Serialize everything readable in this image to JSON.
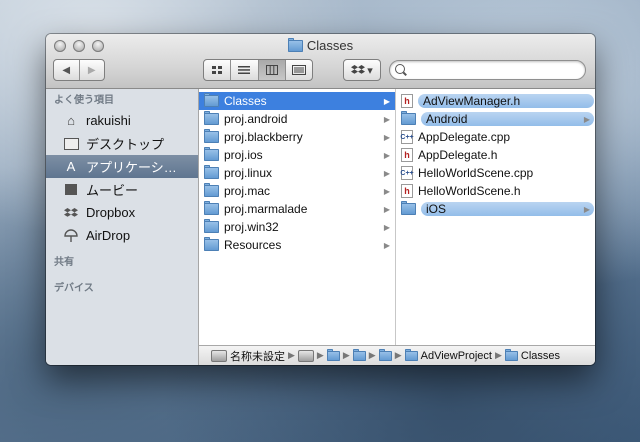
{
  "window": {
    "title": "Classes"
  },
  "toolbar": {
    "back_icon": "◀",
    "forward_icon": "▶",
    "view_icons": [
      "icon-view-icon",
      "list-view-icon",
      "column-view-icon",
      "coverflow-view-icon"
    ],
    "dropbox_menu_arrow": "▾",
    "search_placeholder": ""
  },
  "sidebar": {
    "sections": {
      "favorites": "よく使う項目",
      "shared": "共有",
      "devices": "デバイス"
    },
    "items": [
      {
        "label": "rakuishi",
        "icon": "home-icon"
      },
      {
        "label": "デスクトップ",
        "icon": "desktop-icon"
      },
      {
        "label": "アプリケーシ…",
        "icon": "applications-icon",
        "selected": true
      },
      {
        "label": "ムービー",
        "icon": "movies-icon"
      },
      {
        "label": "Dropbox",
        "icon": "dropbox-icon"
      },
      {
        "label": "AirDrop",
        "icon": "airdrop-icon"
      }
    ]
  },
  "column1": [
    {
      "label": "Classes",
      "selected": true
    },
    {
      "label": "proj.android"
    },
    {
      "label": "proj.blackberry"
    },
    {
      "label": "proj.ios"
    },
    {
      "label": "proj.linux"
    },
    {
      "label": "proj.mac"
    },
    {
      "label": "proj.marmalade"
    },
    {
      "label": "proj.win32"
    },
    {
      "label": "Resources"
    }
  ],
  "column2": [
    {
      "label": "AdViewManager.h",
      "type": "h",
      "highlight": true
    },
    {
      "label": "Android",
      "type": "folder",
      "highlight": true
    },
    {
      "label": "AppDelegate.cpp",
      "type": "cpp"
    },
    {
      "label": "AppDelegate.h",
      "type": "h"
    },
    {
      "label": "HelloWorldScene.cpp",
      "type": "cpp"
    },
    {
      "label": "HelloWorldScene.h",
      "type": "h"
    },
    {
      "label": "iOS",
      "type": "folder",
      "highlight": true
    }
  ],
  "pathbar": {
    "disk": "名称未設定",
    "project": "AdViewProject",
    "current": "Classes"
  },
  "colors": {
    "selection": "#3d80df",
    "sidebar_bg": "#dbe0e6",
    "sidebar_selected": "#6b7f97",
    "pill": "#a8cbee"
  }
}
